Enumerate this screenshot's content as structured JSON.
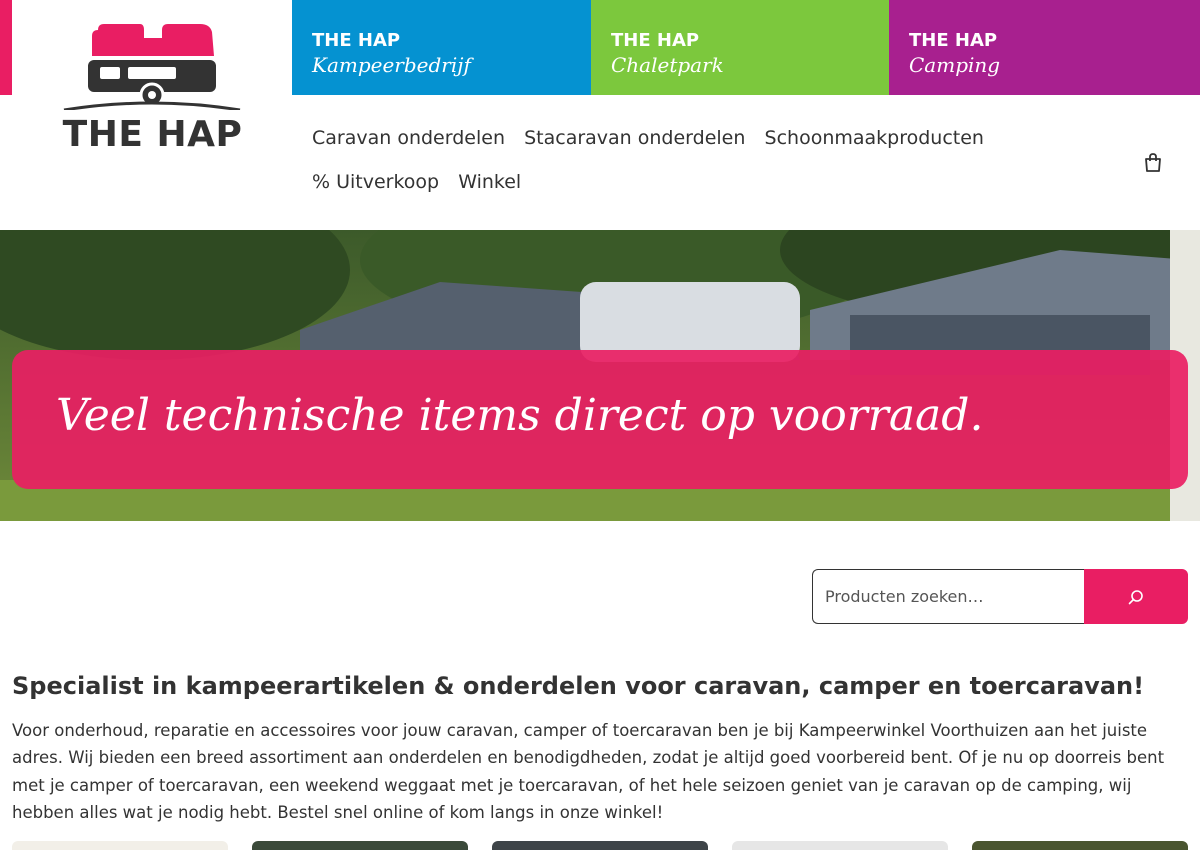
{
  "brand": {
    "logo_text": "THE HAP",
    "accent_color": "#e91e63"
  },
  "brand_tiles": [
    {
      "title": "THE HAP",
      "subtitle": "Kampeerbedrijf",
      "color": "#0592d1"
    },
    {
      "title": "THE HAP",
      "subtitle": "Chaletpark",
      "color": "#7cc83d"
    },
    {
      "title": "THE HAP",
      "subtitle": "Camping",
      "color": "#a8208f"
    }
  ],
  "nav": {
    "items": [
      "Caravan onderdelen",
      "Stacaravan onderdelen",
      "Schoonmaakproducten",
      "% Uitverkoop",
      "Winkel"
    ],
    "cart_icon": "shopping-bag-icon"
  },
  "hero": {
    "banner_text": "Veel technische items direct op voorraad."
  },
  "search": {
    "placeholder": "Producten zoeken…",
    "button_icon": "search-icon"
  },
  "intro": {
    "title": "Specialist in kampeerartikelen & onderdelen voor caravan, camper en toercaravan!",
    "text": "Voor onderhoud, reparatie en accessoires voor jouw caravan, camper of toercaravan ben je bij Kampeerwinkel Voorthuizen aan het juiste adres. Wij bieden een breed assortiment aan onderdelen en benodigdheden, zodat je altijd goed voorbereid bent. Of je nu op doorreis bent met je camper of toercaravan, een weekend weggaat met je toercaravan, of het hele seizoen geniet van je caravan op de camping, wij hebben alles wat je nodig hebt. Bestel snel online of kom langs in onze winkel!"
  }
}
